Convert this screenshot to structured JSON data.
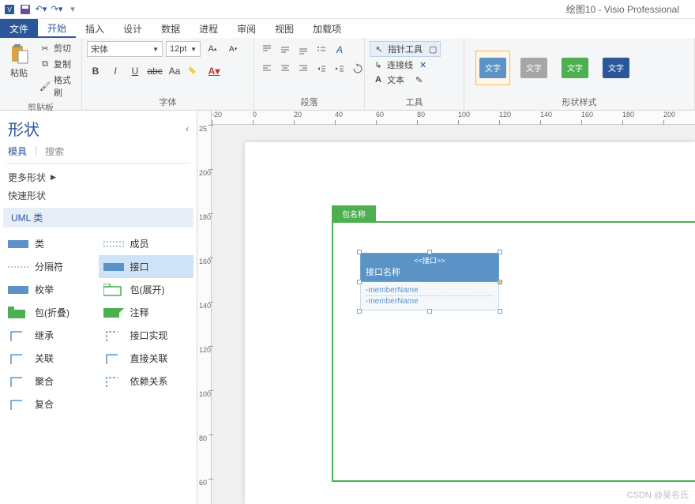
{
  "titlebar": {
    "title": "绘图10 - Visio Professional"
  },
  "tabs": {
    "file": "文件",
    "home": "开始",
    "insert": "插入",
    "design": "设计",
    "data": "数据",
    "process": "进程",
    "review": "审阅",
    "view": "视图",
    "addins": "加载项"
  },
  "ribbon": {
    "clipboard": {
      "label": "剪贴板",
      "paste": "粘贴",
      "cut": "剪切",
      "copy": "复制",
      "format_painter": "格式刷"
    },
    "font": {
      "label": "字体",
      "family": "宋体",
      "size": "12pt",
      "bold": "B",
      "italic": "I",
      "underline": "U",
      "strike": "abc",
      "aa": "Aa",
      "font_color": "A"
    },
    "paragraph": {
      "label": "段落"
    },
    "tools": {
      "label": "工具",
      "pointer": "指针工具",
      "connector": "连接线",
      "text": "文本"
    },
    "styles": {
      "label": "形状样式",
      "sample": "文字",
      "colors": [
        "#5b93c7",
        "#a6a6a6",
        "#4caf50",
        "#2b579a"
      ]
    }
  },
  "shapes_panel": {
    "title": "形状",
    "tab_stencils": "模具",
    "tab_search": "搜索",
    "more_shapes": "更多形状",
    "quick_shapes": "快速形状",
    "section": "UML 类",
    "items": [
      "类",
      "成员",
      "分隔符",
      "接口",
      "枚举",
      "包(展开)",
      "包(折叠)",
      "注释",
      "继承",
      "接口实现",
      "关联",
      "直接关联",
      "聚合",
      "依赖关系",
      "复合"
    ],
    "selected_index": 3
  },
  "canvas": {
    "ruler_h": [
      "-20",
      "0",
      "20",
      "40",
      "60",
      "80",
      "100",
      "120",
      "140",
      "160",
      "180",
      "200"
    ],
    "ruler_v": [
      "25",
      "200",
      "180",
      "160",
      "140",
      "120",
      "100",
      "80",
      "60"
    ],
    "package_label": "包名称",
    "interface": {
      "stereo": "<<接口>>",
      "name": "接口名称",
      "members": [
        "-memberName",
        "-memberName"
      ]
    },
    "watermark": "CSDN @吴名氏"
  }
}
